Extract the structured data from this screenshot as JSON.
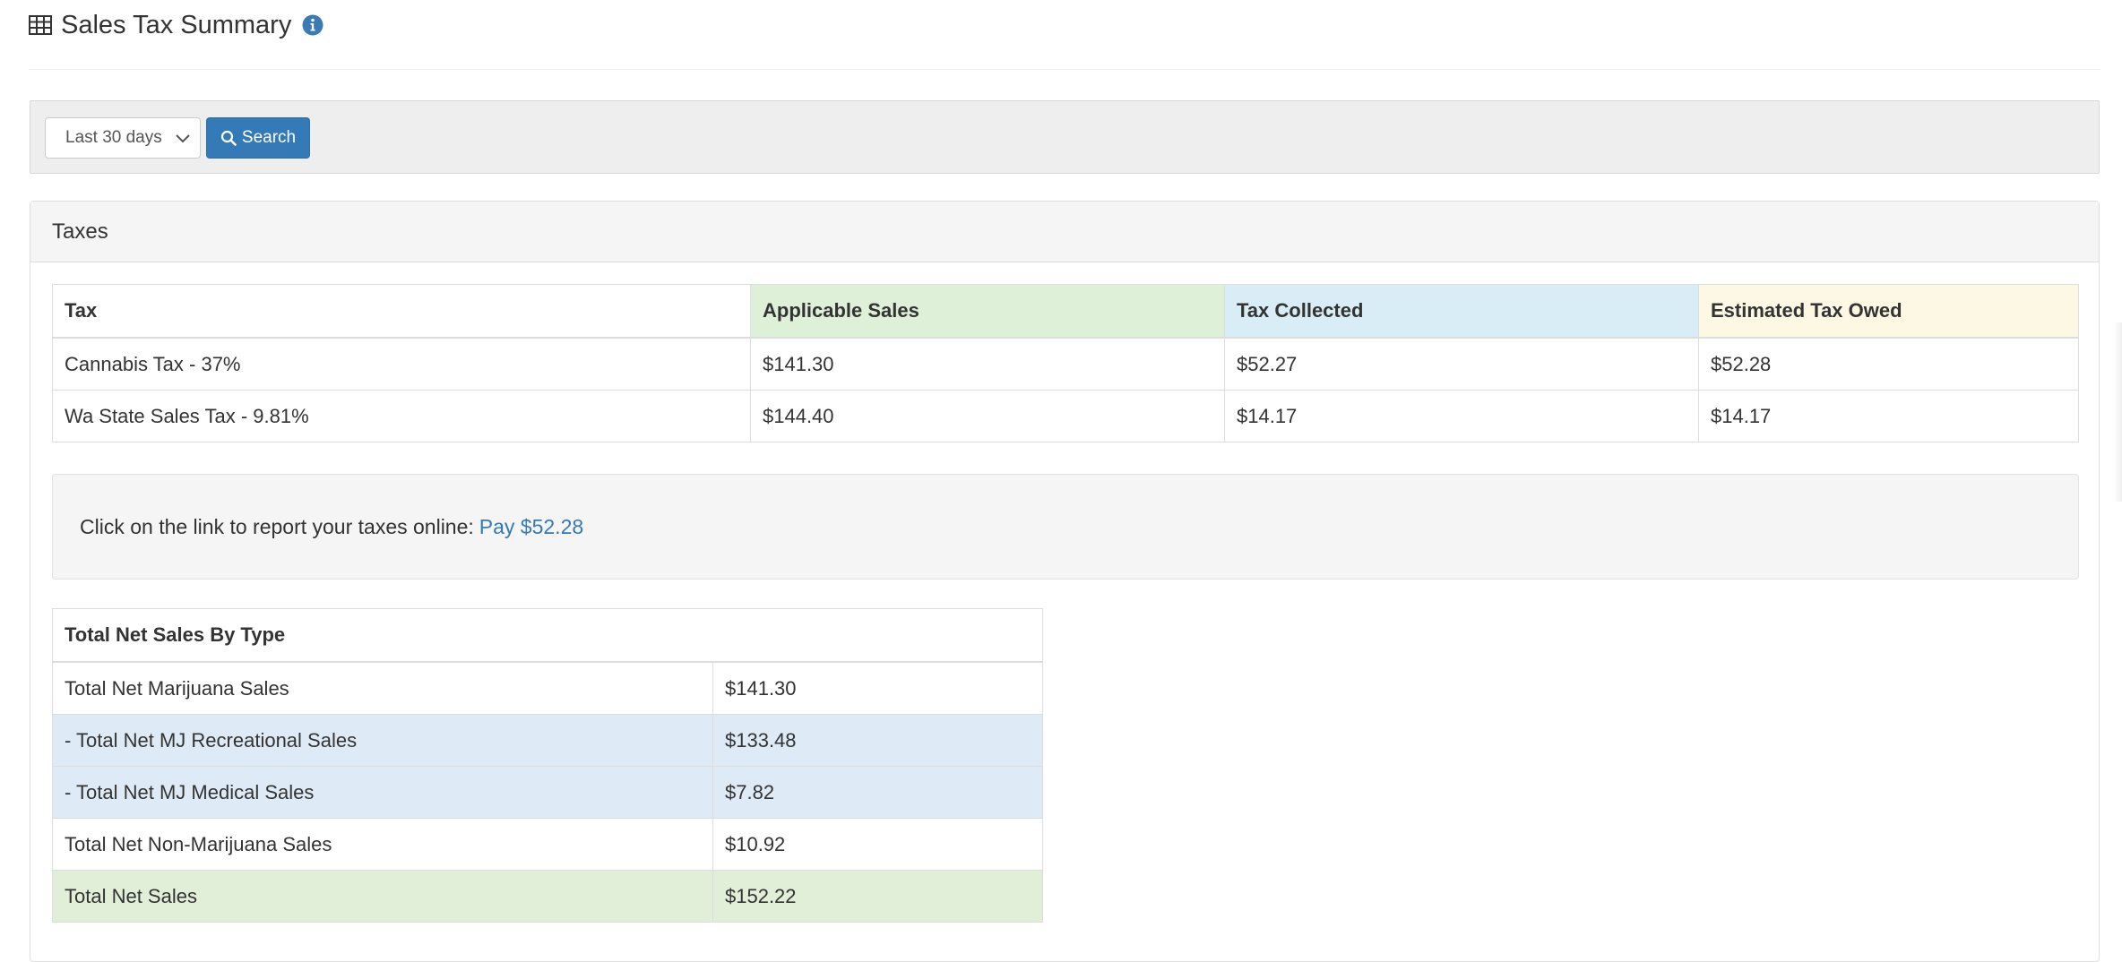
{
  "page": {
    "title": "Sales Tax Summary",
    "title_icon": "table-icon",
    "info_icon": "info-circle-icon"
  },
  "filter": {
    "date_range_selected": "Last 30 days",
    "search_button_label": "Search",
    "search_icon": "search-icon"
  },
  "taxes_panel": {
    "heading": "Taxes",
    "table": {
      "headers": {
        "tax": "Tax",
        "applicable_sales": "Applicable Sales",
        "tax_collected": "Tax Collected",
        "estimated_tax_owed": "Estimated Tax Owed"
      },
      "rows": [
        {
          "tax": "Cannabis Tax - 37%",
          "applicable_sales": "$141.30",
          "tax_collected": "$52.27",
          "estimated_tax_owed": "$52.28"
        },
        {
          "tax": "Wa State Sales Tax - 9.81%",
          "applicable_sales": "$144.40",
          "tax_collected": "$14.17",
          "estimated_tax_owed": "$14.17"
        }
      ]
    },
    "report": {
      "text": "Click on the link to report your taxes online:",
      "link_label": "Pay $52.28"
    },
    "net_sales": {
      "header": "Total Net Sales By Type",
      "rows": [
        {
          "label": "Total Net Marijuana Sales",
          "value": "$141.30"
        },
        {
          "label": "- Total Net MJ Recreational Sales",
          "value": "$133.48"
        },
        {
          "label": "- Total Net MJ Medical Sales",
          "value": "$7.82"
        },
        {
          "label": "Total Net Non-Marijuana Sales",
          "value": "$10.92"
        },
        {
          "label": "Total Net Sales",
          "value": "$152.22"
        }
      ]
    }
  },
  "colors": {
    "primary": "#337ab7",
    "success_bg": "#dff0d8",
    "info_bg": "#d9edf7",
    "warning_bg": "#fcf8e3"
  }
}
